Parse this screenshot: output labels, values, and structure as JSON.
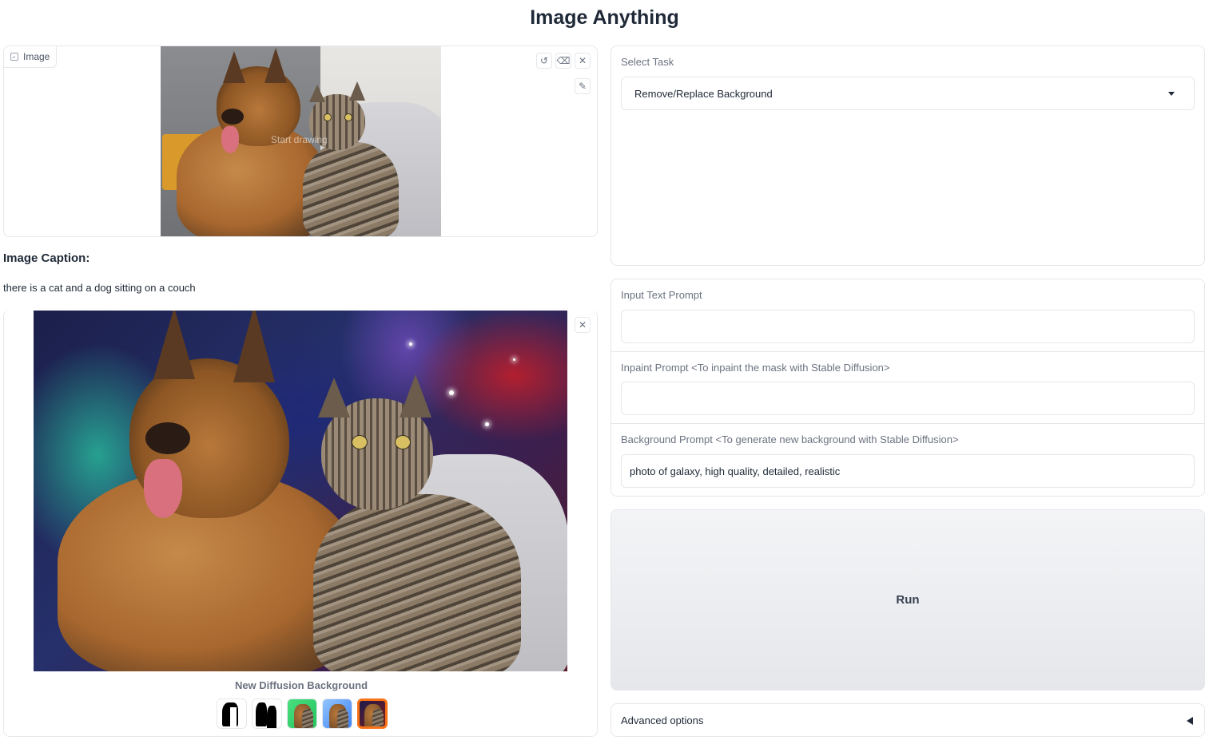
{
  "app": {
    "title": "Image Anything"
  },
  "input_image": {
    "label": "Image",
    "watermark": "Start drawing",
    "tools": [
      "undo-icon",
      "eraser-icon",
      "close-icon",
      "brush-icon"
    ]
  },
  "caption": {
    "heading": "Image Caption:",
    "text": "there is a cat and a dog sitting on a couch"
  },
  "gallery": {
    "caption": "New Diffusion Background",
    "thumbnails": [
      "mask",
      "mask-inverted",
      "green-background",
      "blue-background",
      "galaxy-background"
    ],
    "selected_index": 4
  },
  "task": {
    "label": "Select Task",
    "value": "Remove/Replace Background"
  },
  "prompts": {
    "input_label": "Input Text Prompt",
    "input_value": "",
    "inpaint_label": "Inpaint Prompt <To inpaint the mask with Stable Diffusion>",
    "inpaint_value": "",
    "background_label": "Background Prompt <To generate new background with Stable Diffusion>",
    "background_value": "photo of galaxy, high quality, detailed, realistic"
  },
  "run": {
    "label": "Run"
  },
  "advanced": {
    "label": "Advanced options"
  },
  "colors": {
    "accent": "#f97316",
    "border": "#e5e7eb",
    "muted": "#6b7280"
  }
}
